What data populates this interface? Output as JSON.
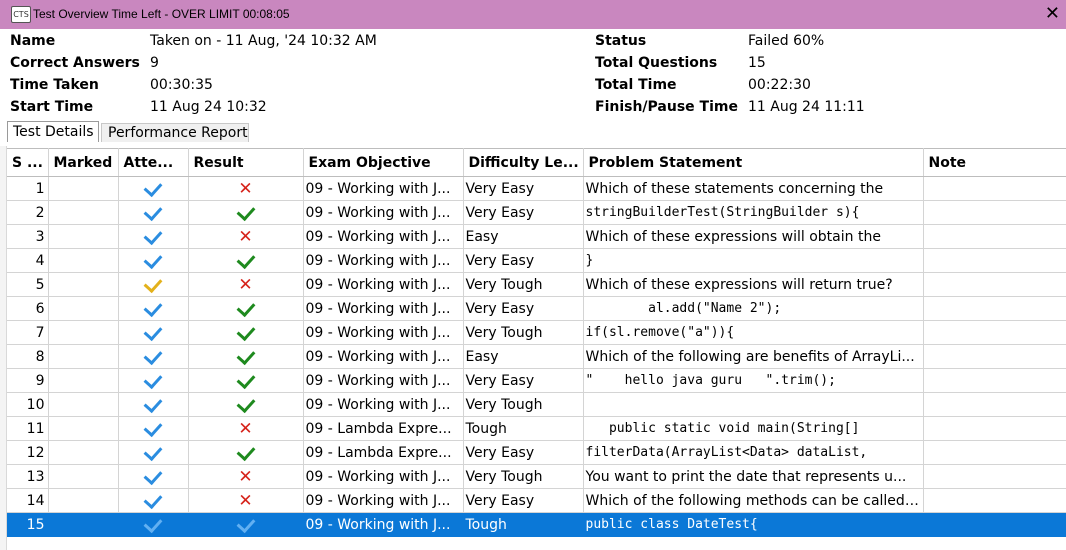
{
  "window": {
    "icon_label": "CTS",
    "title": "Test Overview   Time Left - OVER LIMIT 00:08:05"
  },
  "summary": {
    "name_label": "Name",
    "name_value": "Taken on - 11 Aug, '24 10:32 AM",
    "correct_label": "Correct Answers",
    "correct_value": "9",
    "time_taken_label": "Time Taken",
    "time_taken_value": "00:30:35",
    "start_label": "Start Time",
    "start_value": "11 Aug 24 10:32",
    "status_label": "Status",
    "status_value": "Failed 60%",
    "total_q_label": "Total Questions",
    "total_q_value": "15",
    "total_time_label": "Total Time",
    "total_time_value": "00:22:30",
    "finish_label": "Finish/Pause Time",
    "finish_value": "11 Aug 24 11:11"
  },
  "tabs": [
    "Test Details",
    "Performance Report"
  ],
  "table": {
    "headers": [
      "S ...",
      "Marked",
      "Atte...",
      "Result",
      "Exam Objective",
      "Difficulty Le...",
      "Problem Statement",
      "Note"
    ],
    "rows": [
      {
        "n": "1",
        "marked": "",
        "attempt": "blue",
        "result": "wrong",
        "objective": "09 - Working with J...",
        "difficulty": "Very Easy",
        "problem": "Which of these statements concerning the",
        "mono": false,
        "note": ""
      },
      {
        "n": "2",
        "marked": "",
        "attempt": "blue",
        "result": "correct",
        "objective": "09 - Working with J...",
        "difficulty": "Very Easy",
        "problem": "stringBuilderTest(StringBuilder s){",
        "mono": true,
        "note": ""
      },
      {
        "n": "3",
        "marked": "",
        "attempt": "blue",
        "result": "wrong",
        "objective": "09 - Working with J...",
        "difficulty": "Easy",
        "problem": "Which of these expressions will obtain the",
        "mono": false,
        "note": ""
      },
      {
        "n": "4",
        "marked": "",
        "attempt": "blue",
        "result": "correct",
        "objective": "09 - Working with J...",
        "difficulty": "Very Easy",
        "problem": "}",
        "mono": true,
        "note": ""
      },
      {
        "n": "5",
        "marked": "",
        "attempt": "yellow",
        "result": "wrong",
        "objective": "09 - Working with J...",
        "difficulty": "Very Tough",
        "problem": "Which of these expressions will return true?",
        "mono": false,
        "note": ""
      },
      {
        "n": "6",
        "marked": "",
        "attempt": "blue",
        "result": "correct",
        "objective": "09 - Working with J...",
        "difficulty": "Very Easy",
        "problem": "        al.add(\"Name 2\");",
        "mono": true,
        "note": ""
      },
      {
        "n": "7",
        "marked": "",
        "attempt": "blue",
        "result": "correct",
        "objective": "09 - Working with J...",
        "difficulty": "Very Tough",
        "problem": "if(sl.remove(\"a\")){",
        "mono": true,
        "note": ""
      },
      {
        "n": "8",
        "marked": "",
        "attempt": "blue",
        "result": "correct",
        "objective": "09 - Working with J...",
        "difficulty": "Easy",
        "problem": "Which of the following are benefits of ArrayLi...",
        "mono": false,
        "note": ""
      },
      {
        "n": "9",
        "marked": "",
        "attempt": "blue",
        "result": "correct",
        "objective": "09 - Working with J...",
        "difficulty": "Very Easy",
        "problem": "\"    hello java guru   \".trim();",
        "mono": true,
        "note": ""
      },
      {
        "n": "10",
        "marked": "",
        "attempt": "blue",
        "result": "correct",
        "objective": "09 - Working with J...",
        "difficulty": "Very Tough",
        "problem": "",
        "mono": true,
        "note": ""
      },
      {
        "n": "11",
        "marked": "",
        "attempt": "blue",
        "result": "wrong",
        "objective": "09 - Lambda Expre...",
        "difficulty": "Tough",
        "problem": "   public static void main(String[]",
        "mono": true,
        "note": ""
      },
      {
        "n": "12",
        "marked": "",
        "attempt": "blue",
        "result": "correct",
        "objective": "09 - Lambda Expre...",
        "difficulty": "Very Easy",
        "problem": "filterData(ArrayList<Data> dataList,",
        "mono": true,
        "note": ""
      },
      {
        "n": "13",
        "marked": "",
        "attempt": "blue",
        "result": "wrong",
        "objective": "09 - Working with J...",
        "difficulty": "Very Tough",
        "problem": "You want to print the date that represents u...",
        "mono": false,
        "note": ""
      },
      {
        "n": "14",
        "marked": "",
        "attempt": "blue",
        "result": "wrong",
        "objective": "09 - Working with J...",
        "difficulty": "Very Easy",
        "problem": "Which of the following methods can be called ...",
        "mono": false,
        "note": ""
      },
      {
        "n": "15",
        "marked": "",
        "attempt": "blue",
        "result": "correct",
        "objective": "09 - Working with J...",
        "difficulty": "Tough",
        "problem": "public class DateTest{",
        "mono": true,
        "note": ""
      }
    ],
    "selected_row": "15"
  },
  "colors": {
    "titlebar": "#c987bf",
    "selection": "#0b78d7",
    "check_blue": "#2b8de0",
    "check_green": "#1e8a1e",
    "cross_red": "#d6231b",
    "check_yellow": "#e3b11b"
  }
}
